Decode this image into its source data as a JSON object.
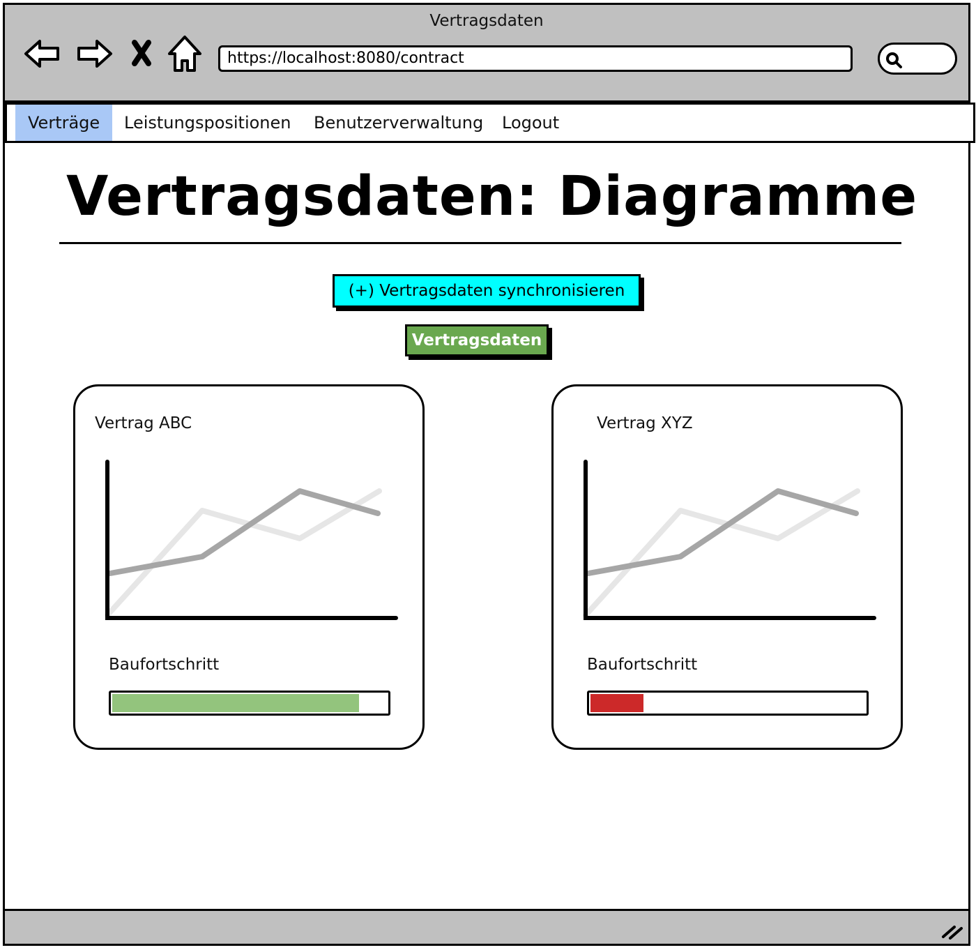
{
  "window": {
    "title": "Vertragsdaten"
  },
  "browser": {
    "url": "https://localhost:8080/contract",
    "icons": [
      "back-arrow-icon",
      "forward-arrow-icon",
      "close-icon",
      "home-icon",
      "search-icon",
      "resize-grip-icon"
    ]
  },
  "menu": {
    "items": [
      {
        "label": "Verträge",
        "active": true
      },
      {
        "label": "Leistungspositionen",
        "active": false
      },
      {
        "label": "Benutzerverwaltung",
        "active": false
      },
      {
        "label": "Logout",
        "active": false
      }
    ],
    "active_color": "#a9c8f6"
  },
  "page": {
    "title": "Vertragsdaten: Diagramme",
    "sync_button": "(+) Vertragsdaten synchronisieren",
    "data_button": "Vertragsdaten",
    "sync_button_color": "#00ffff",
    "data_button_color": "#6aa84f"
  },
  "cards": [
    {
      "title": "Vertrag ABC",
      "progress_label": "Baufortschritt",
      "progress": 0.9,
      "progress_color": "#93c47d"
    },
    {
      "title": "Vertrag XYZ",
      "progress_label": "Baufortschritt",
      "progress": 0.2,
      "progress_color": "#cc2929"
    }
  ]
}
